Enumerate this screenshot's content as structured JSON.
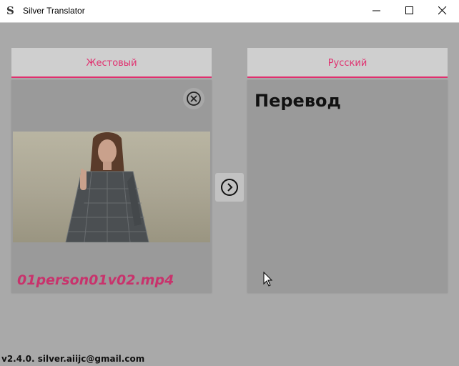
{
  "window": {
    "title": "Silver Translator",
    "logo_letter": "S"
  },
  "tabs": {
    "source": "Жестовый",
    "target": "Русский"
  },
  "input_panel": {
    "file_name": "01person01v02.mp4"
  },
  "output_panel": {
    "text": "Перевод"
  },
  "footer": {
    "version": "v2.4.0. silver.aiijc@gmail.com"
  },
  "colors": {
    "accent": "#e0306f",
    "background": "#a9a9a9",
    "panel": "#9a9a9a",
    "tab": "#cfcfcf"
  },
  "icons": {
    "remove": "close-circle-icon",
    "translate": "chevron-right-circle-icon",
    "cursor": "mouse-pointer-icon"
  }
}
